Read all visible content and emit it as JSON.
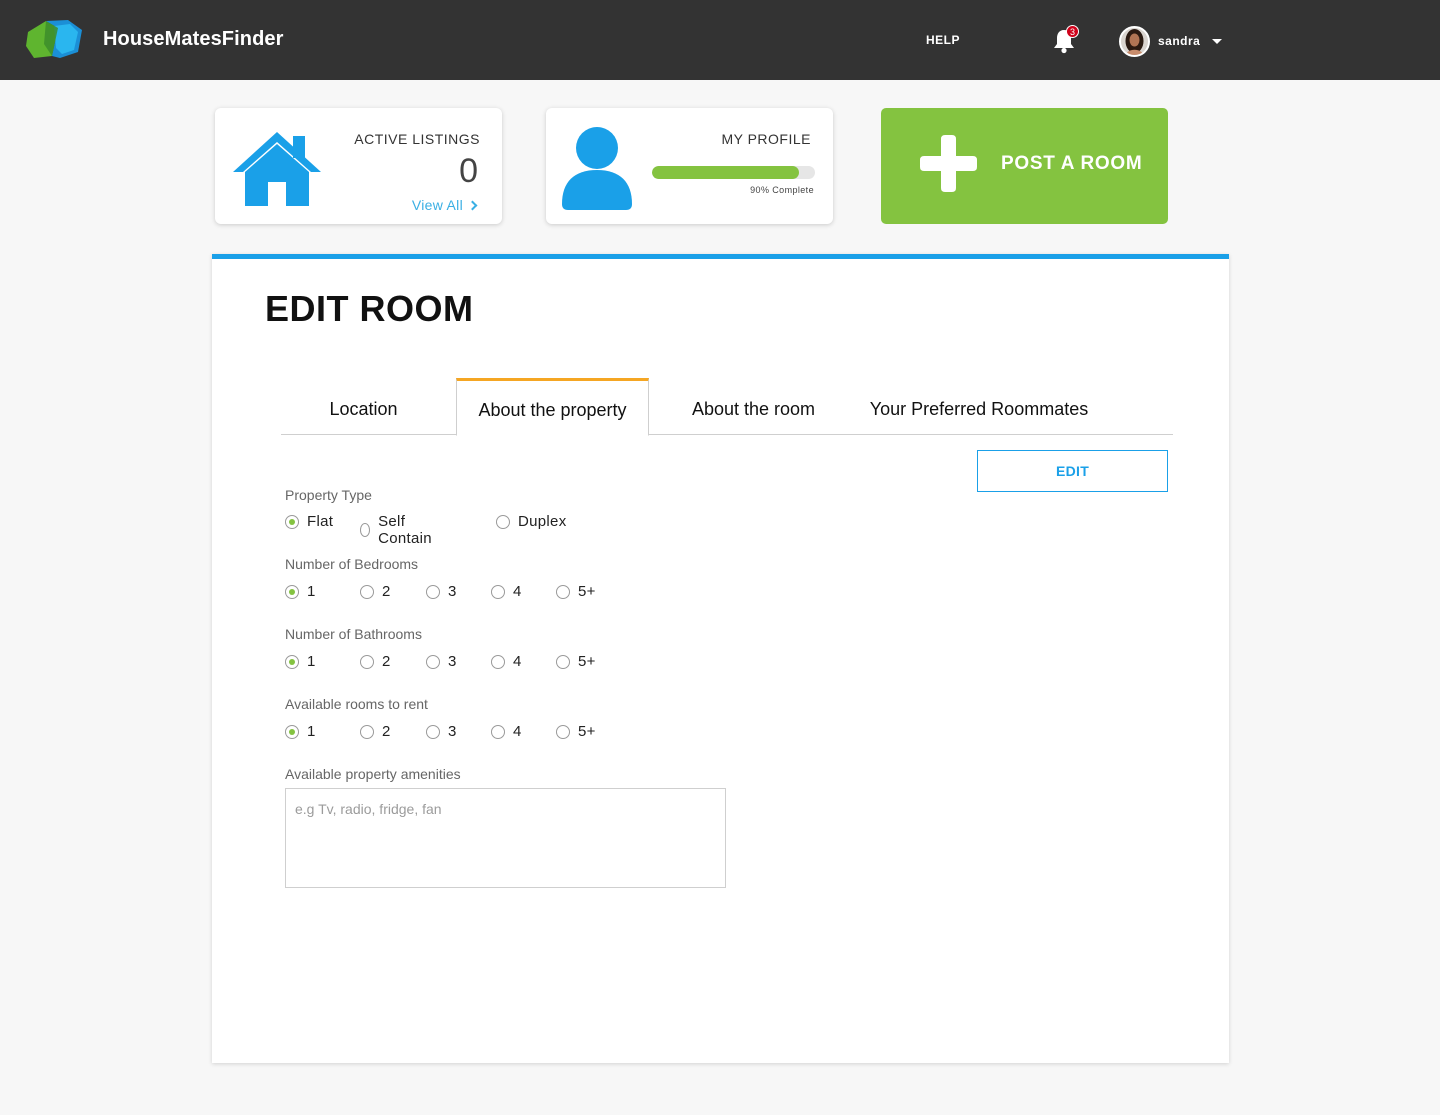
{
  "header": {
    "brand": "HouseMatesFinder",
    "help_label": "HELP",
    "notification_count": "3",
    "username": "sandra"
  },
  "cards": {
    "listings": {
      "title": "ACTIVE LISTINGS",
      "count": "0",
      "link_label": "View All"
    },
    "profile": {
      "title": "MY PROFILE",
      "progress_percent": 90,
      "progress_label": "90% Complete"
    },
    "post": {
      "label": "POST A ROOM"
    }
  },
  "page": {
    "title": "EDIT ROOM",
    "tabs": [
      "Location",
      "About the property",
      "About the room",
      "Your Preferred Roommates"
    ],
    "active_tab": "About the property",
    "edit_label": "EDIT"
  },
  "form": {
    "property_type": {
      "label": "Property Type",
      "options": [
        "Flat",
        "Self Contain",
        "Duplex"
      ],
      "selected": "Flat"
    },
    "bedrooms": {
      "label": "Number of Bedrooms",
      "options": [
        "1",
        "2",
        "3",
        "4",
        "5+"
      ],
      "selected": "1"
    },
    "bathrooms": {
      "label": "Number of Bathrooms",
      "options": [
        "1",
        "2",
        "3",
        "4",
        "5+"
      ],
      "selected": "1"
    },
    "rooms_to_rent": {
      "label": "Available rooms to rent",
      "options": [
        "1",
        "2",
        "3",
        "4",
        "5+"
      ],
      "selected": "1"
    },
    "amenities": {
      "label": "Available property amenities",
      "placeholder": "e.g Tv, radio, fridge, fan",
      "value": ""
    }
  },
  "colors": {
    "topbar": "#333333",
    "accent_blue": "#1aa0e8",
    "brand_green": "#84c340",
    "tab_active_border": "#f5a623",
    "badge_red": "#d0021b"
  },
  "icons": [
    "logo-icon",
    "bell-icon",
    "caret-down-icon",
    "house-icon",
    "chevron-right-icon",
    "person-icon",
    "plus-icon"
  ]
}
